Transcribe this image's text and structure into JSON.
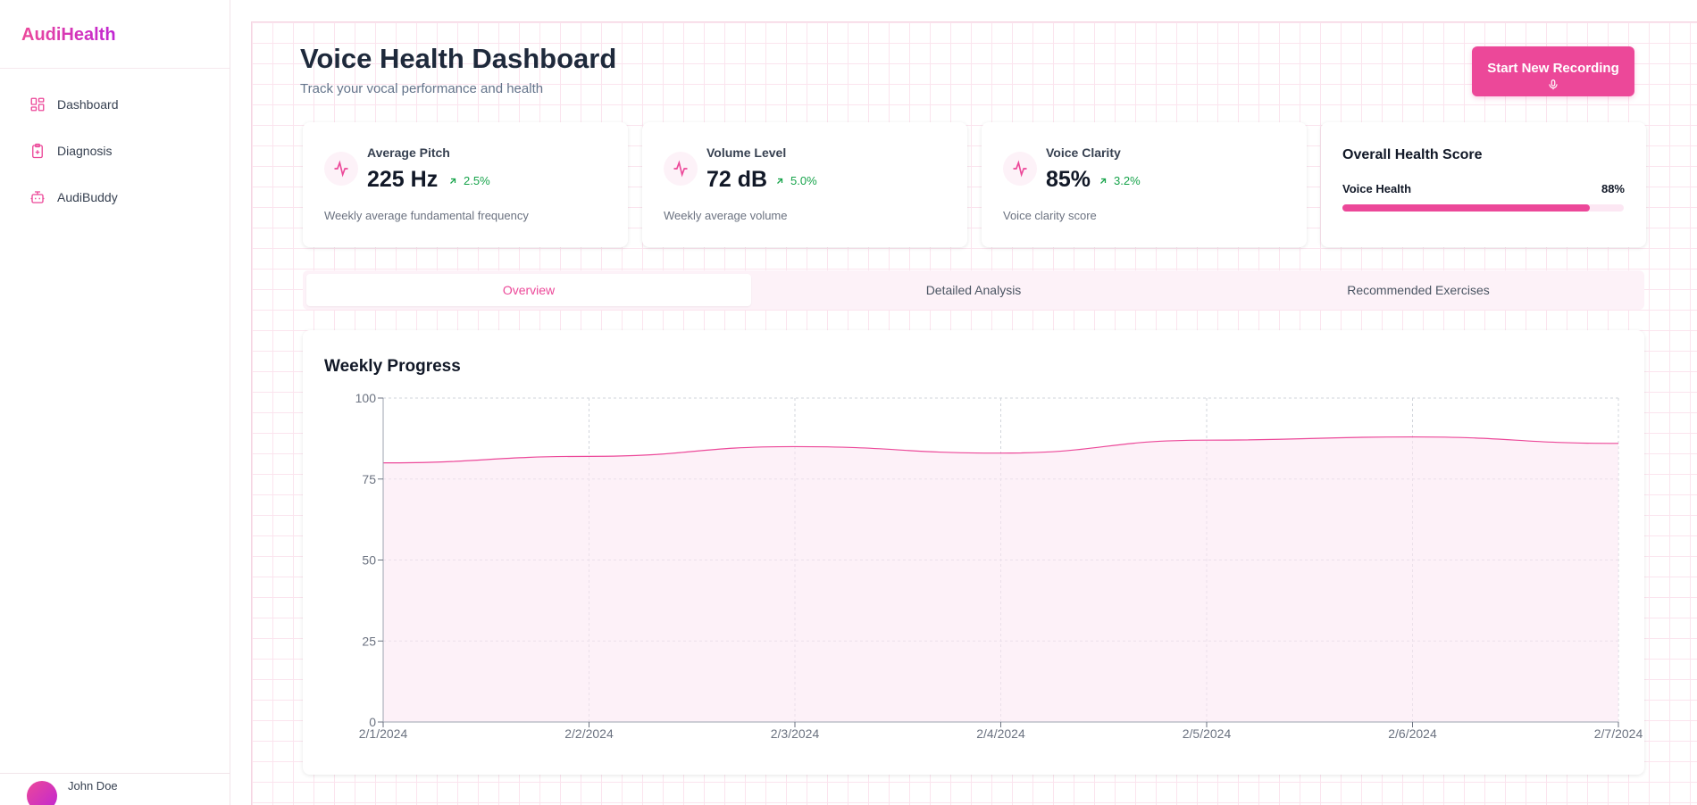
{
  "app": {
    "brand": "AudiHealth",
    "accent": "#ec4899"
  },
  "sidebar": {
    "items": [
      {
        "label": "Dashboard",
        "icon": "dashboard-grid-icon"
      },
      {
        "label": "Diagnosis",
        "icon": "clipboard-plus-icon"
      },
      {
        "label": "AudiBuddy",
        "icon": "bot-icon"
      }
    ],
    "user": {
      "name": "John Doe"
    }
  },
  "header": {
    "title": "Voice Health Dashboard",
    "subtitle": "Track your vocal performance and health",
    "record_button": "Start New Recording",
    "record_icon": "mic-icon"
  },
  "stats": [
    {
      "label": "Average Pitch",
      "value": "225 Hz",
      "change": "2.5%",
      "description": "Weekly average fundamental frequency",
      "icon": "activity-icon"
    },
    {
      "label": "Volume Level",
      "value": "72 dB",
      "change": "5.0%",
      "description": "Weekly average volume",
      "icon": "activity-icon"
    },
    {
      "label": "Voice Clarity",
      "value": "85%",
      "change": "3.2%",
      "description": "Voice clarity score",
      "icon": "activity-icon"
    }
  ],
  "health": {
    "title": "Overall Health Score",
    "label": "Voice Health",
    "percent_text": "88%",
    "value": 0.88
  },
  "tabs": [
    {
      "label": "Overview",
      "active": true
    },
    {
      "label": "Detailed Analysis",
      "active": false
    },
    {
      "label": "Recommended Exercises",
      "active": false
    }
  ],
  "chart": {
    "title": "Weekly Progress"
  },
  "chart_data": {
    "type": "area",
    "x": [
      "2/1/2024",
      "2/2/2024",
      "2/3/2024",
      "2/4/2024",
      "2/5/2024",
      "2/6/2024",
      "2/7/2024"
    ],
    "values": [
      80,
      82,
      85,
      83,
      87,
      88,
      86
    ],
    "ylim": [
      0,
      100
    ],
    "yticks": [
      0,
      25,
      50,
      75,
      100
    ],
    "grid": true,
    "line_color": "#ec4899",
    "fill_color": "#fce7f3"
  }
}
